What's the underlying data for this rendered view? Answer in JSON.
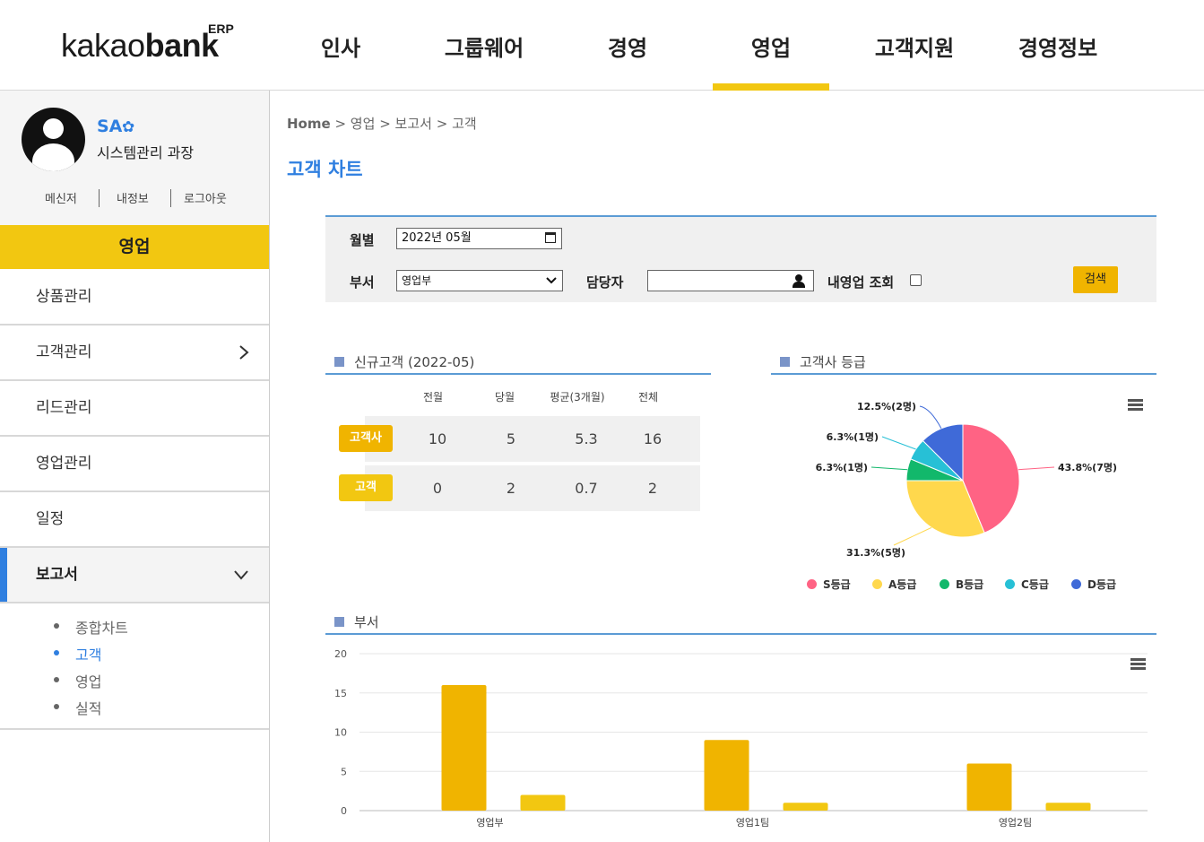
{
  "header": {
    "logo_prefix": "kakao",
    "logo_bold": "bank",
    "logo_suffix": "ERP",
    "nav": [
      "인사",
      "그룹웨어",
      "경영",
      "영업",
      "고객지원",
      "경영정보"
    ],
    "active_nav": "영업"
  },
  "profile": {
    "name": "SA",
    "role": "시스템관리 과장",
    "links": [
      "메신저",
      "내정보",
      "로그아웃"
    ]
  },
  "sidebar": {
    "section": "영업",
    "items": [
      "상품관리",
      "고객관리",
      "리드관리",
      "영업관리",
      "일정",
      "보고서"
    ],
    "active_item": "보고서",
    "subitems": [
      "종합차트",
      "고객",
      "영업",
      "실적"
    ],
    "active_subitem": "고객"
  },
  "breadcrumb": {
    "home": "Home",
    "path": [
      "영업",
      "보고서",
      "고객"
    ]
  },
  "page_title": "고객 차트",
  "search": {
    "month_label": "월별",
    "month_value": "2022년 05월",
    "dept_label": "부서",
    "dept_value": "영업부",
    "manager_label": "담당자",
    "manager_value": "",
    "mine_label": "내영업 조회",
    "button": "검색"
  },
  "new_customers": {
    "title": "신규고객 (2022-05)",
    "columns": [
      "전월",
      "당월",
      "평균(3개월)",
      "전체"
    ],
    "rows": [
      {
        "label": "고객사",
        "color": "#f0b400",
        "values": [
          "10",
          "5",
          "5.3",
          "16"
        ]
      },
      {
        "label": "고객",
        "color": "#f2c711",
        "values": [
          "0",
          "2",
          "0.7",
          "2"
        ]
      }
    ]
  },
  "grade_chart": {
    "title": "고객사 등급",
    "legend": [
      "S등급",
      "A등급",
      "B등급",
      "C등급",
      "D등급"
    ],
    "colors": [
      "#ff6384",
      "#ffd84d",
      "#12b86b",
      "#27c0d6",
      "#3f6ad8"
    ]
  },
  "dept_chart": {
    "title": "부서"
  },
  "chart_data": [
    {
      "type": "pie",
      "title": "고객사 등급",
      "categories": [
        "S등급",
        "A등급",
        "B등급",
        "C등급",
        "D등급"
      ],
      "values": [
        7,
        5,
        1,
        1,
        2
      ],
      "labels": [
        "43.8%(7명)",
        "31.3%(5명)",
        "6.3%(1명)",
        "6.3%(1명)",
        "12.5%(2명)"
      ],
      "legend": "bottom"
    },
    {
      "type": "bar",
      "title": "부서",
      "categories": [
        "영업부",
        "영업1팀",
        "영업2팀"
      ],
      "series": [
        {
          "values": [
            16,
            9,
            6
          ],
          "color": "#f0b400"
        },
        {
          "values": [
            2,
            1,
            1
          ],
          "color": "#f2c711"
        }
      ],
      "ylim": [
        0,
        20
      ],
      "yticks": [
        0,
        5,
        10,
        15,
        20
      ],
      "grid": true
    }
  ]
}
